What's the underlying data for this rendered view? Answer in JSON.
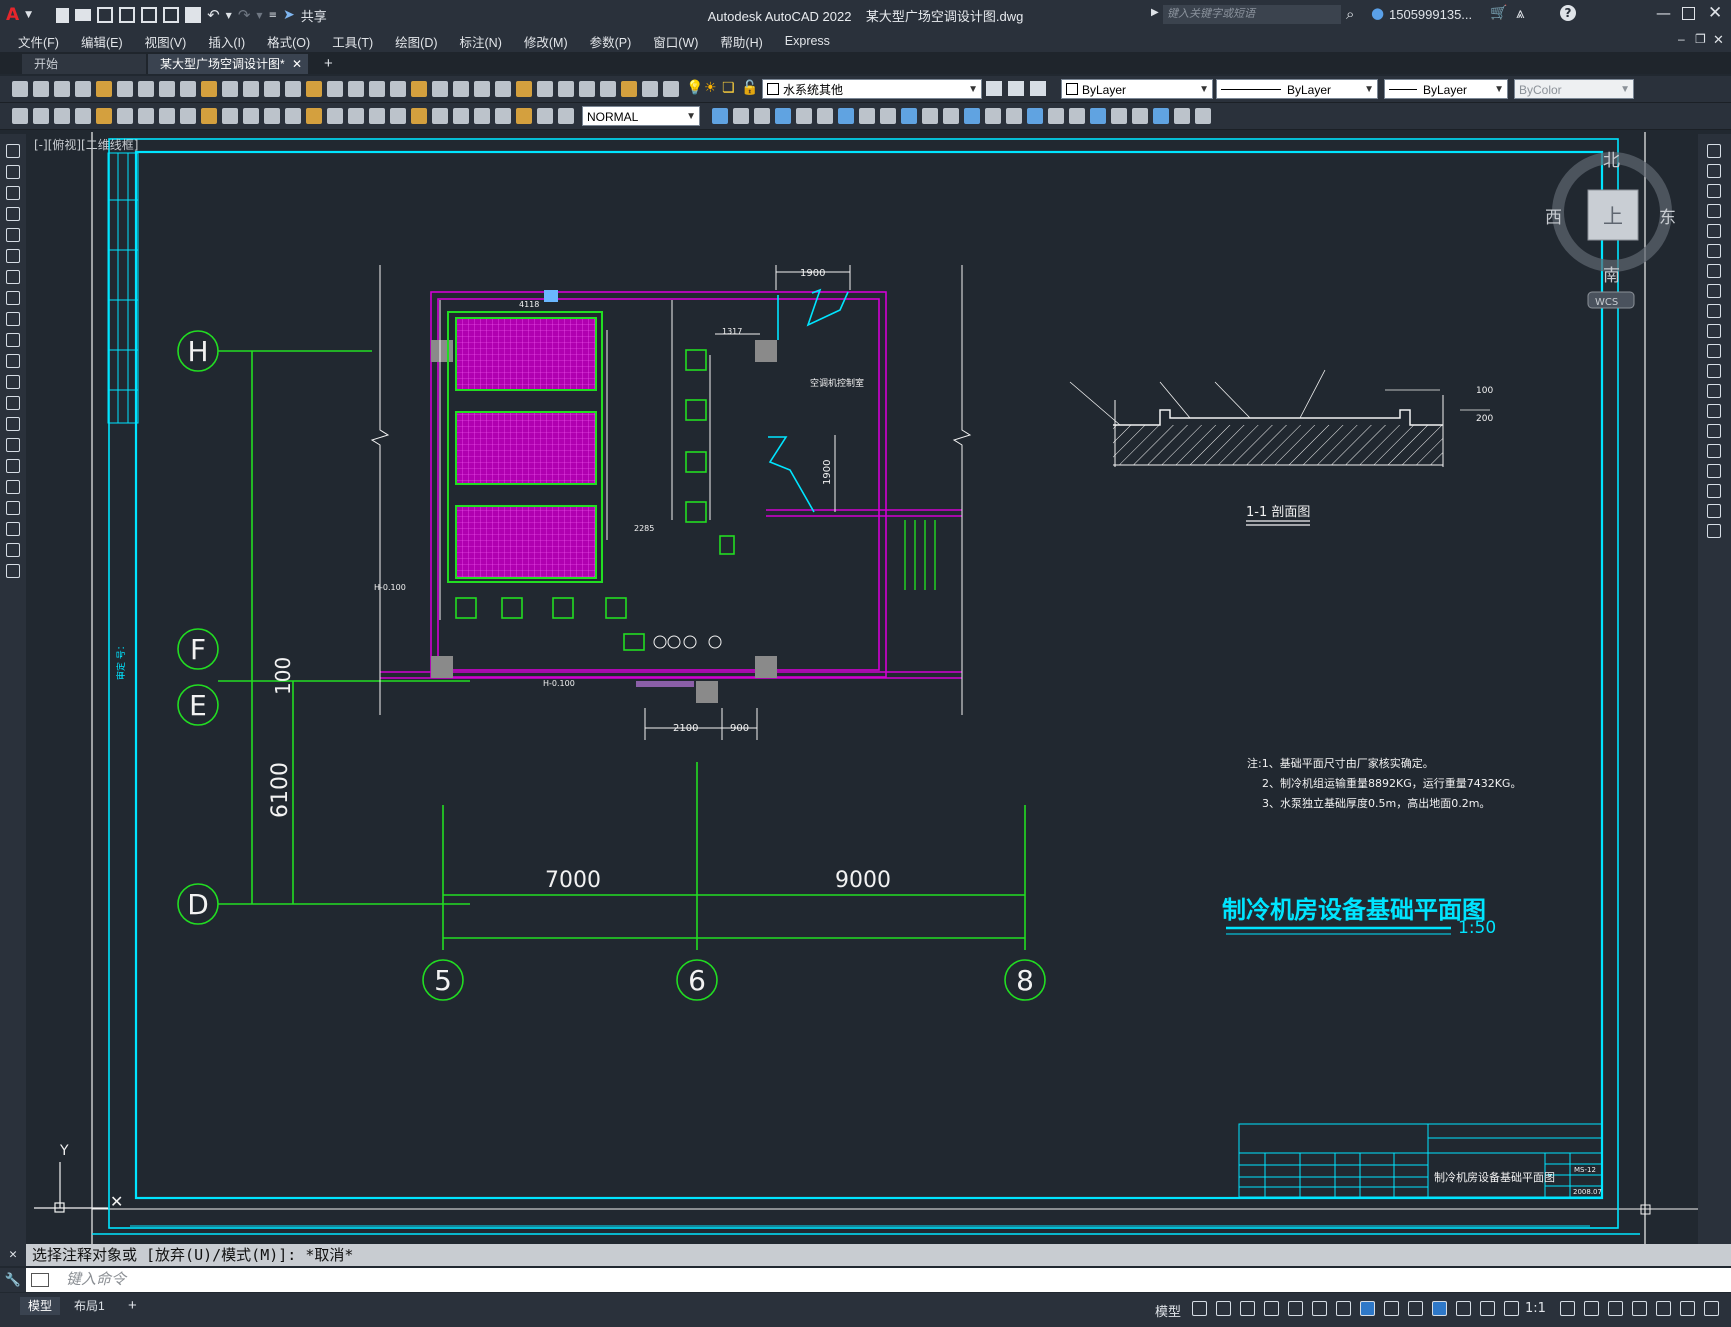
{
  "app": {
    "title_app": "Autodesk AutoCAD 2022",
    "title_file": "某大型广场空调设计图.dwg",
    "share_label": "共享",
    "search_placeholder": "键入关键字或短语",
    "user": "1505999135...",
    "logo_letter": "A"
  },
  "menu": [
    "文件(F)",
    "编辑(E)",
    "视图(V)",
    "插入(I)",
    "格式(O)",
    "工具(T)",
    "绘图(D)",
    "标注(N)",
    "修改(M)",
    "参数(P)",
    "窗口(W)",
    "帮助(H)",
    "Express"
  ],
  "tabs": {
    "start": "开始",
    "drawing": "某大型广场空调设计图*",
    "add": "+"
  },
  "properties": {
    "layer": "水系统其他",
    "color": "ByLayer",
    "linetype": "ByLayer",
    "lineweight": "ByLayer",
    "plotstyle": "ByColor",
    "dimstyle": "NORMAL"
  },
  "viewport": {
    "label": "[-][俯视][二维线框]",
    "viewcube": {
      "north": "北",
      "south": "南",
      "east": "东",
      "west": "西",
      "top": "上",
      "wcs": "WCS"
    },
    "ucs_y": "Y"
  },
  "drawing": {
    "grid_rows": [
      "H",
      "F",
      "E",
      "D"
    ],
    "grid_cols": [
      "5",
      "6",
      "8"
    ],
    "dims": {
      "d7000": "7000",
      "d9000": "9000",
      "d6100": "6100",
      "d100": "100",
      "d1900a": "1900",
      "d1900b": "1900",
      "d2100": "2100",
      "d900": "900",
      "d4118": "4118",
      "d1317": "1317",
      "d2285": "2285"
    },
    "room_label": "空调机控制室",
    "section_title": "1-1 剖面图",
    "section_dims": {
      "w": "100",
      "h": "200"
    },
    "notes": [
      "注:1、基础平面尺寸由厂家核实确定。",
      "2、制冷机组运输重量8892KG，运行重量7432KG。",
      "3、水泵独立基础厚度0.5m，高出地面0.2m。"
    ],
    "main_title": "制冷机房设备基础平面图",
    "scale": "1:50",
    "title_block_name": "制冷机房设备基础平面图",
    "title_block_no": "MS-12",
    "title_block_date": "2008.07",
    "elev1": "H-0.100",
    "elev2": "H-0.100"
  },
  "command": {
    "history": "选择注释对象或 [放弃(U)/模式(M)]: *取消*",
    "placeholder": "键入命令"
  },
  "status": {
    "model_tab": "模型",
    "layout_tab": "布局1",
    "model_label": "模型",
    "scale": "1:1"
  },
  "colors": {
    "bg": "#212830",
    "frame": "#00e5ff",
    "grid": "#22dd22",
    "magenta": "#d200d2",
    "white": "#f2f2f2"
  }
}
